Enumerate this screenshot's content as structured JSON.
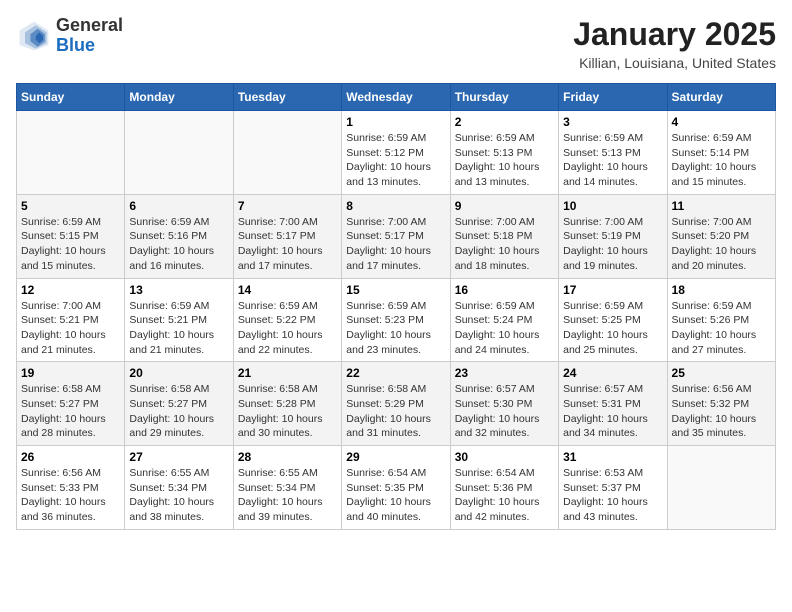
{
  "header": {
    "logo_general": "General",
    "logo_blue": "Blue",
    "month_title": "January 2025",
    "location": "Killian, Louisiana, United States"
  },
  "days_of_week": [
    "Sunday",
    "Monday",
    "Tuesday",
    "Wednesday",
    "Thursday",
    "Friday",
    "Saturday"
  ],
  "weeks": [
    [
      {
        "num": "",
        "info": ""
      },
      {
        "num": "",
        "info": ""
      },
      {
        "num": "",
        "info": ""
      },
      {
        "num": "1",
        "info": "Sunrise: 6:59 AM\nSunset: 5:12 PM\nDaylight: 10 hours\nand 13 minutes."
      },
      {
        "num": "2",
        "info": "Sunrise: 6:59 AM\nSunset: 5:13 PM\nDaylight: 10 hours\nand 13 minutes."
      },
      {
        "num": "3",
        "info": "Sunrise: 6:59 AM\nSunset: 5:13 PM\nDaylight: 10 hours\nand 14 minutes."
      },
      {
        "num": "4",
        "info": "Sunrise: 6:59 AM\nSunset: 5:14 PM\nDaylight: 10 hours\nand 15 minutes."
      }
    ],
    [
      {
        "num": "5",
        "info": "Sunrise: 6:59 AM\nSunset: 5:15 PM\nDaylight: 10 hours\nand 15 minutes."
      },
      {
        "num": "6",
        "info": "Sunrise: 6:59 AM\nSunset: 5:16 PM\nDaylight: 10 hours\nand 16 minutes."
      },
      {
        "num": "7",
        "info": "Sunrise: 7:00 AM\nSunset: 5:17 PM\nDaylight: 10 hours\nand 17 minutes."
      },
      {
        "num": "8",
        "info": "Sunrise: 7:00 AM\nSunset: 5:17 PM\nDaylight: 10 hours\nand 17 minutes."
      },
      {
        "num": "9",
        "info": "Sunrise: 7:00 AM\nSunset: 5:18 PM\nDaylight: 10 hours\nand 18 minutes."
      },
      {
        "num": "10",
        "info": "Sunrise: 7:00 AM\nSunset: 5:19 PM\nDaylight: 10 hours\nand 19 minutes."
      },
      {
        "num": "11",
        "info": "Sunrise: 7:00 AM\nSunset: 5:20 PM\nDaylight: 10 hours\nand 20 minutes."
      }
    ],
    [
      {
        "num": "12",
        "info": "Sunrise: 7:00 AM\nSunset: 5:21 PM\nDaylight: 10 hours\nand 21 minutes."
      },
      {
        "num": "13",
        "info": "Sunrise: 6:59 AM\nSunset: 5:21 PM\nDaylight: 10 hours\nand 21 minutes."
      },
      {
        "num": "14",
        "info": "Sunrise: 6:59 AM\nSunset: 5:22 PM\nDaylight: 10 hours\nand 22 minutes."
      },
      {
        "num": "15",
        "info": "Sunrise: 6:59 AM\nSunset: 5:23 PM\nDaylight: 10 hours\nand 23 minutes."
      },
      {
        "num": "16",
        "info": "Sunrise: 6:59 AM\nSunset: 5:24 PM\nDaylight: 10 hours\nand 24 minutes."
      },
      {
        "num": "17",
        "info": "Sunrise: 6:59 AM\nSunset: 5:25 PM\nDaylight: 10 hours\nand 25 minutes."
      },
      {
        "num": "18",
        "info": "Sunrise: 6:59 AM\nSunset: 5:26 PM\nDaylight: 10 hours\nand 27 minutes."
      }
    ],
    [
      {
        "num": "19",
        "info": "Sunrise: 6:58 AM\nSunset: 5:27 PM\nDaylight: 10 hours\nand 28 minutes."
      },
      {
        "num": "20",
        "info": "Sunrise: 6:58 AM\nSunset: 5:27 PM\nDaylight: 10 hours\nand 29 minutes."
      },
      {
        "num": "21",
        "info": "Sunrise: 6:58 AM\nSunset: 5:28 PM\nDaylight: 10 hours\nand 30 minutes."
      },
      {
        "num": "22",
        "info": "Sunrise: 6:58 AM\nSunset: 5:29 PM\nDaylight: 10 hours\nand 31 minutes."
      },
      {
        "num": "23",
        "info": "Sunrise: 6:57 AM\nSunset: 5:30 PM\nDaylight: 10 hours\nand 32 minutes."
      },
      {
        "num": "24",
        "info": "Sunrise: 6:57 AM\nSunset: 5:31 PM\nDaylight: 10 hours\nand 34 minutes."
      },
      {
        "num": "25",
        "info": "Sunrise: 6:56 AM\nSunset: 5:32 PM\nDaylight: 10 hours\nand 35 minutes."
      }
    ],
    [
      {
        "num": "26",
        "info": "Sunrise: 6:56 AM\nSunset: 5:33 PM\nDaylight: 10 hours\nand 36 minutes."
      },
      {
        "num": "27",
        "info": "Sunrise: 6:55 AM\nSunset: 5:34 PM\nDaylight: 10 hours\nand 38 minutes."
      },
      {
        "num": "28",
        "info": "Sunrise: 6:55 AM\nSunset: 5:34 PM\nDaylight: 10 hours\nand 39 minutes."
      },
      {
        "num": "29",
        "info": "Sunrise: 6:54 AM\nSunset: 5:35 PM\nDaylight: 10 hours\nand 40 minutes."
      },
      {
        "num": "30",
        "info": "Sunrise: 6:54 AM\nSunset: 5:36 PM\nDaylight: 10 hours\nand 42 minutes."
      },
      {
        "num": "31",
        "info": "Sunrise: 6:53 AM\nSunset: 5:37 PM\nDaylight: 10 hours\nand 43 minutes."
      },
      {
        "num": "",
        "info": ""
      }
    ]
  ]
}
